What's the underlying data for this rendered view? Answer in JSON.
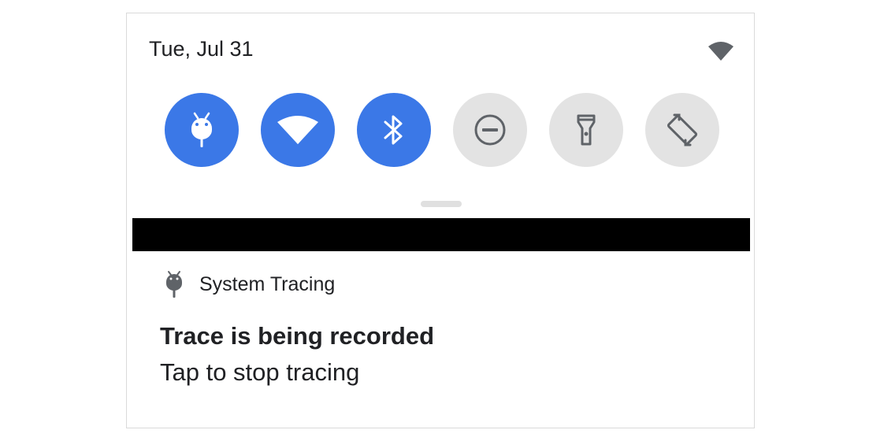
{
  "status": {
    "date": "Tue, Jul 31",
    "wifi_icon": "wifi-signal-icon"
  },
  "quick_settings": {
    "tiles": [
      {
        "name": "system-tracing",
        "icon": "android-tracing-icon",
        "state": "on"
      },
      {
        "name": "wifi",
        "icon": "wifi-icon",
        "state": "on"
      },
      {
        "name": "bluetooth",
        "icon": "bluetooth-icon",
        "state": "on"
      },
      {
        "name": "do-not-disturb",
        "icon": "do-not-disturb-icon",
        "state": "off"
      },
      {
        "name": "flashlight",
        "icon": "flashlight-icon",
        "state": "off"
      },
      {
        "name": "auto-rotate",
        "icon": "auto-rotate-icon",
        "state": "off"
      }
    ],
    "colors": {
      "on": "#3b78e7",
      "off": "#e3e3e3",
      "icon_on": "#ffffff",
      "icon_off": "#5f6368"
    }
  },
  "notification": {
    "app_name": "System Tracing",
    "app_icon": "android-tracing-icon",
    "title": "Trace is being recorded",
    "text": "Tap to stop tracing"
  }
}
